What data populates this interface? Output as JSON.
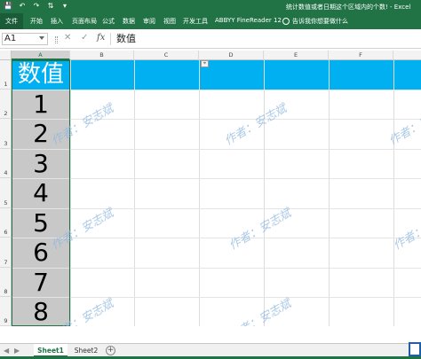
{
  "titlebar": {
    "title": "统计数值或者日期这个区域内的个数! - Excel",
    "qat": [
      {
        "icon": "save-icon",
        "glyph": "💾"
      },
      {
        "icon": "undo-icon",
        "glyph": "↶"
      },
      {
        "icon": "redo-icon",
        "glyph": "↷"
      },
      {
        "icon": "sort-icon",
        "glyph": "⇅"
      },
      {
        "icon": "customize-icon",
        "glyph": "▾"
      }
    ]
  },
  "ribbon": {
    "tabs": [
      "文件",
      "开始",
      "插入",
      "页面布局",
      "公式",
      "数据",
      "审阅",
      "视图",
      "开发工具",
      "ABBYY FineReader 12"
    ],
    "tell_me": "告诉我你想要做什么"
  },
  "formula_bar": {
    "name_box": "A1",
    "cancel_glyph": "✕",
    "enter_glyph": "✓",
    "fx_label": "fx",
    "content": "数值"
  },
  "grid": {
    "columns": [
      "A",
      "B",
      "C",
      "D",
      "E",
      "F"
    ],
    "rows": [
      "1",
      "2",
      "3",
      "4",
      "5",
      "6",
      "7",
      "8",
      "9"
    ],
    "header_cell": "数值",
    "values": [
      "1",
      "2",
      "3",
      "4",
      "5",
      "6",
      "7",
      "8"
    ],
    "header_fill": "#00b0f0",
    "column_a_fill": "#c8c8c8",
    "accent": "#217346"
  },
  "watermark": "作者：安志斌",
  "sheets": {
    "tabs": [
      "Sheet1",
      "Sheet2"
    ],
    "active": "Sheet1",
    "nav_prev": "◀",
    "nav_next": "▶",
    "add_glyph": "+"
  }
}
